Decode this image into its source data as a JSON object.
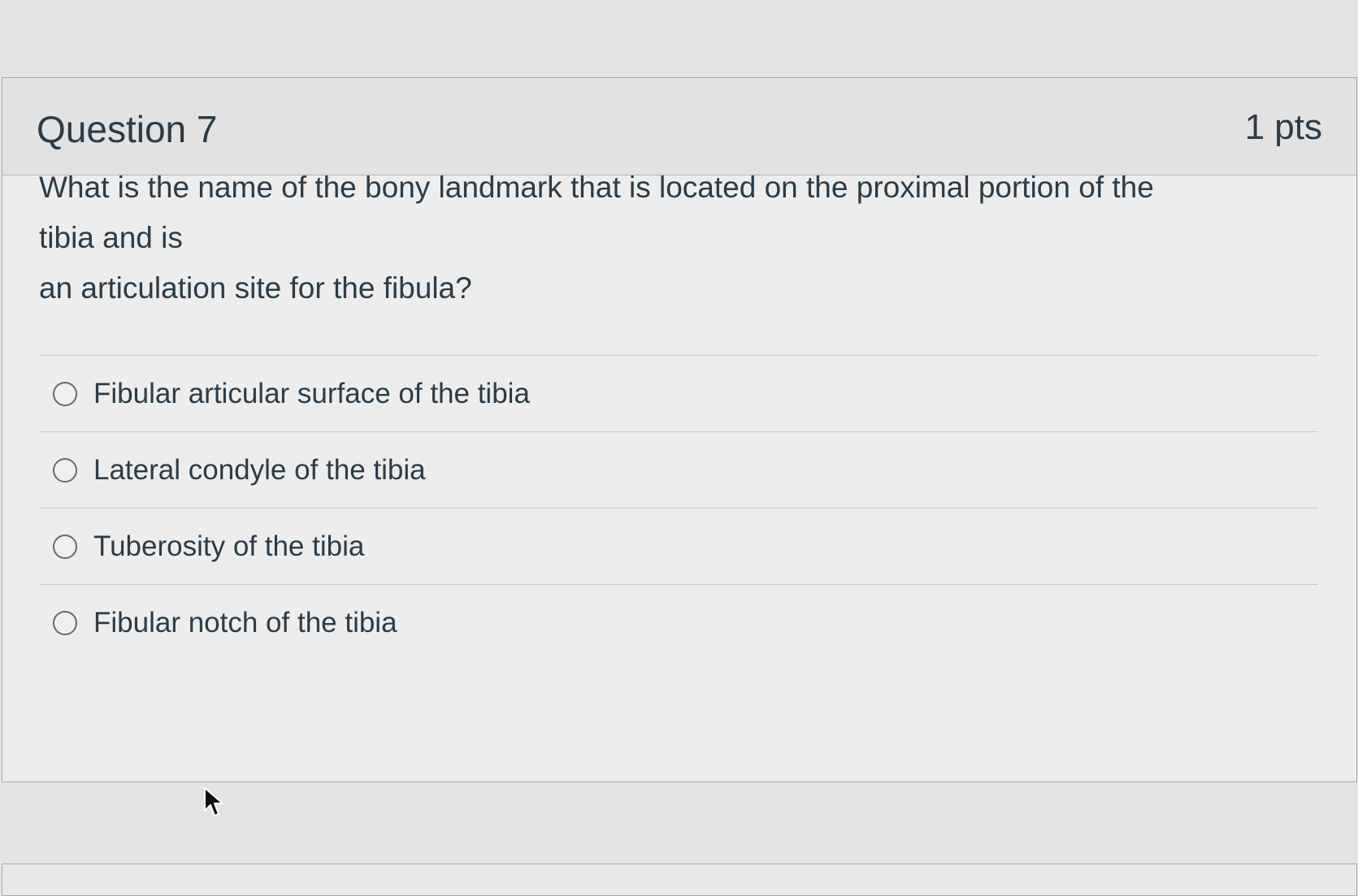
{
  "question": {
    "title": "Question 7",
    "points": "1 pts",
    "text_line1": "What is the name of the bony landmark that is located on the proximal portion of the",
    "text_line2": "tibia and is",
    "text_line3": "an articulation site for the fibula?"
  },
  "answers": [
    {
      "label": "Fibular articular surface of the tibia",
      "selected": false
    },
    {
      "label": "Lateral condyle of the tibia",
      "selected": false
    },
    {
      "label": "Tuberosity of the tibia",
      "selected": false
    },
    {
      "label": "Fibular notch of the tibia",
      "selected": false
    }
  ],
  "cursor": {
    "icon": "mouse-pointer-icon"
  }
}
